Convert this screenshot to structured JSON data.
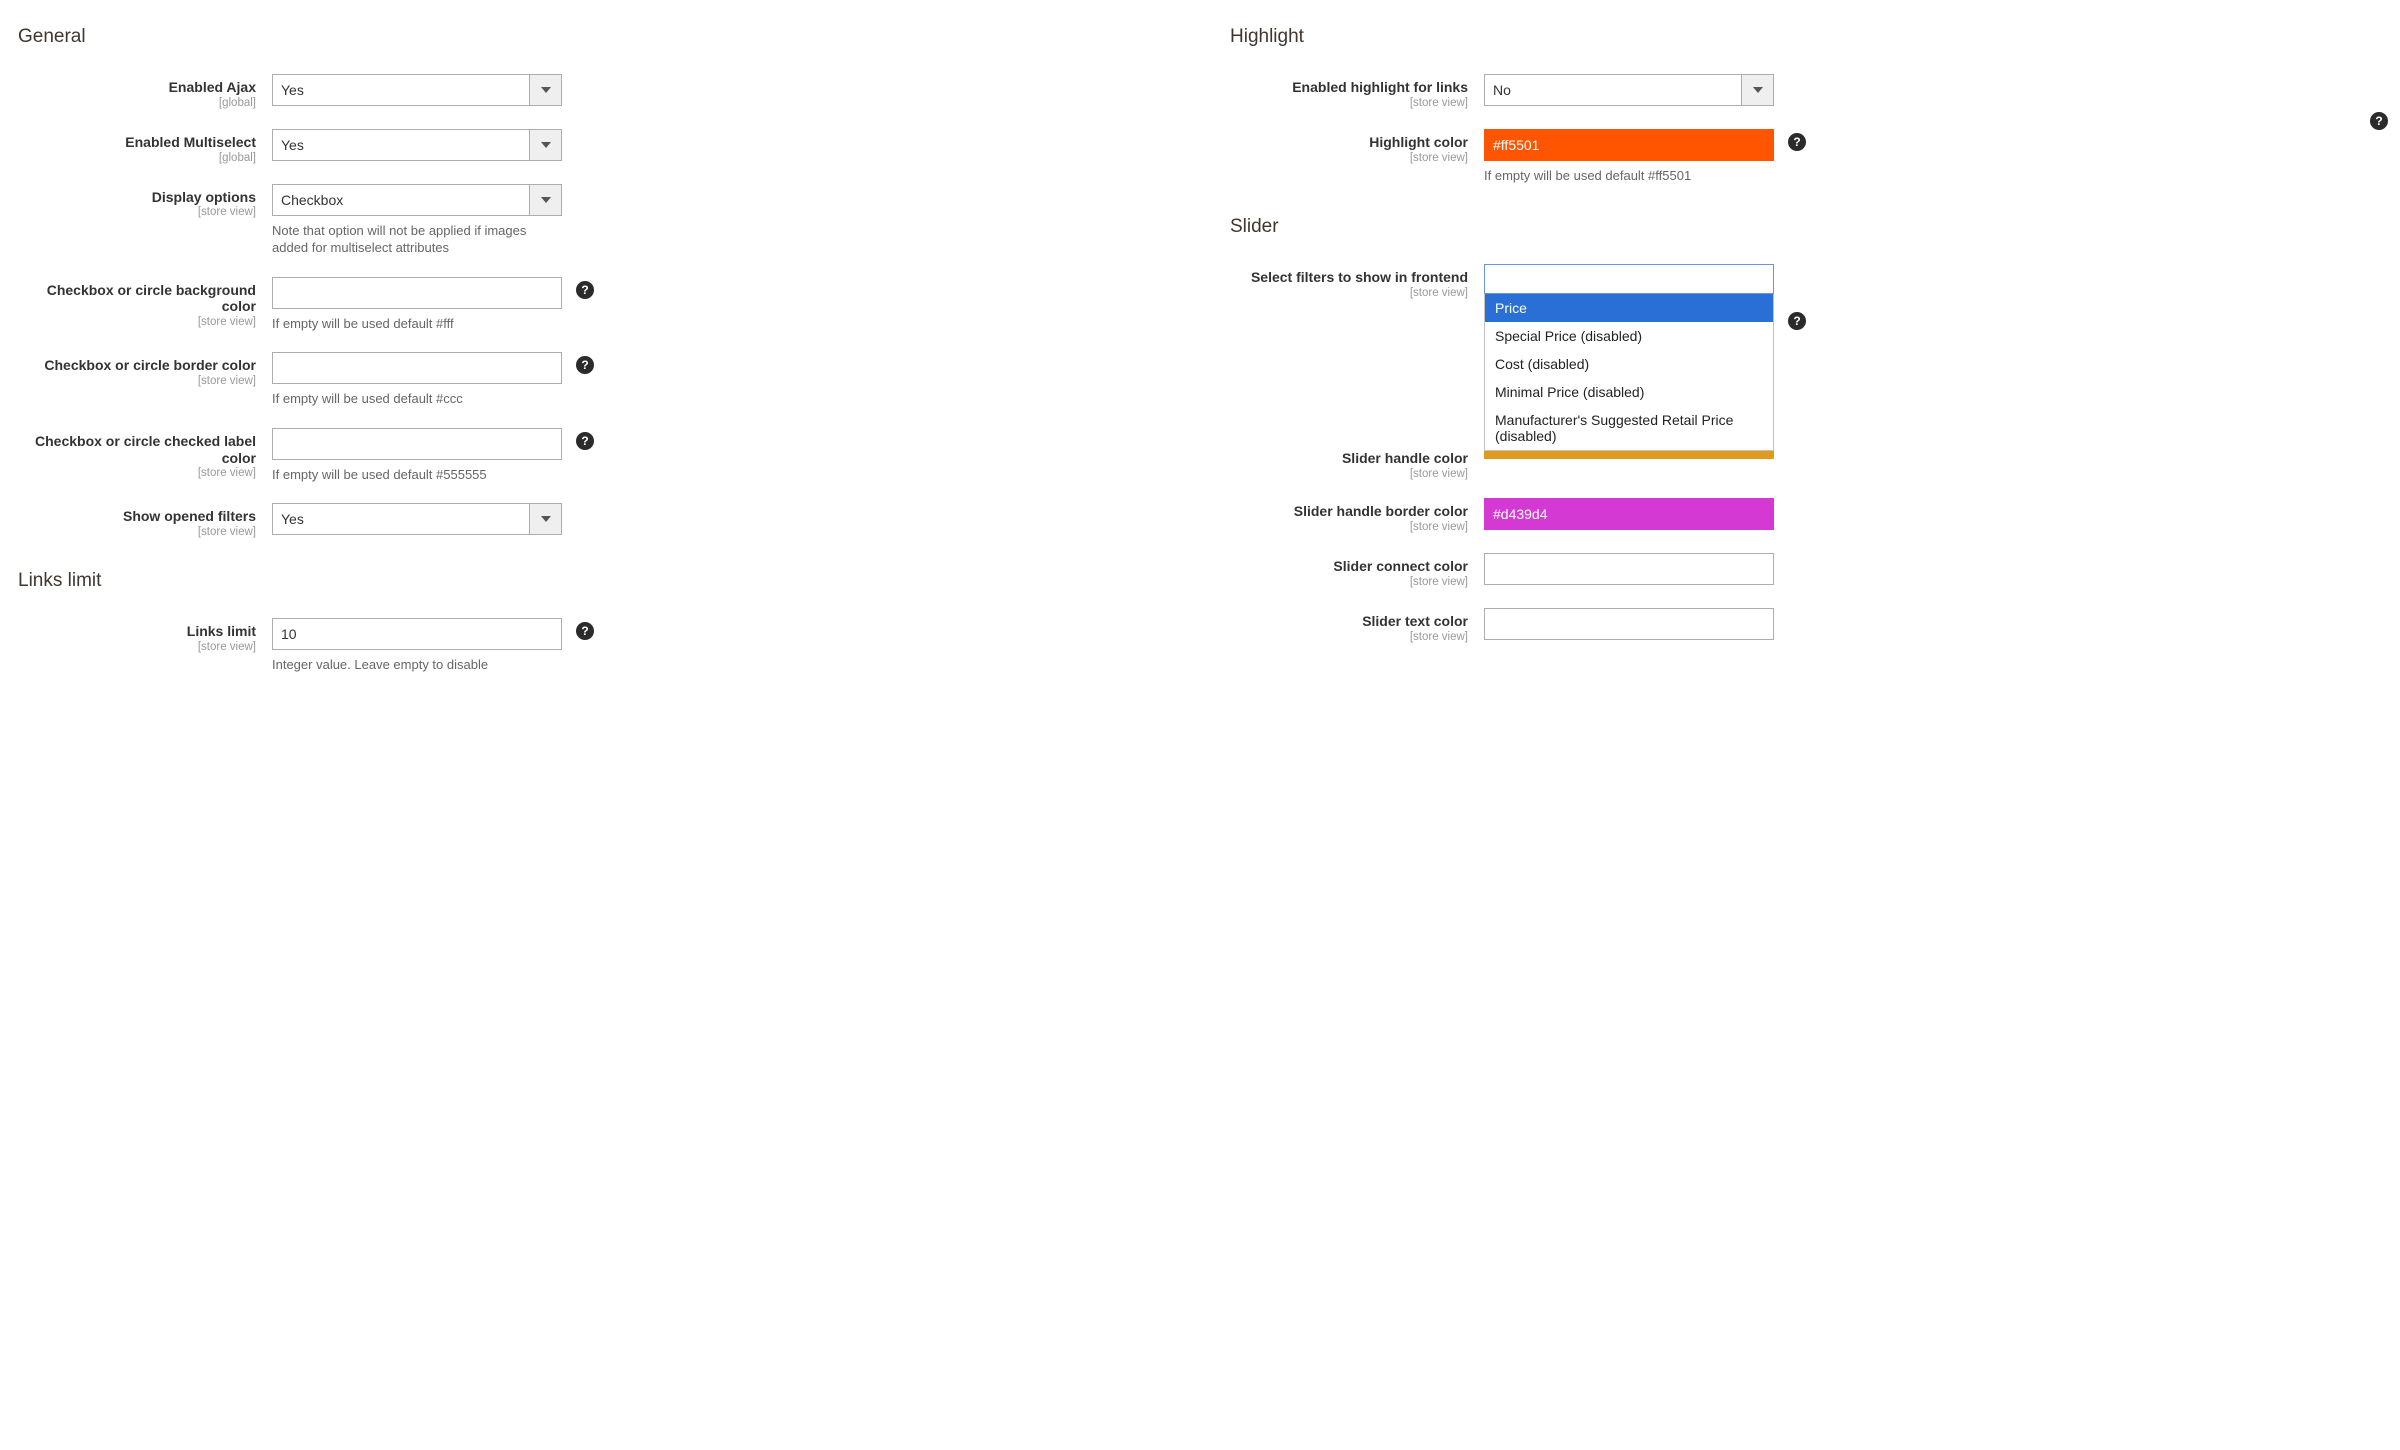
{
  "scope": {
    "global": "[global]",
    "store_view": "[store view]"
  },
  "help_glyph": "?",
  "general": {
    "title": "General",
    "enabled_ajax": {
      "label": "Enabled Ajax",
      "value": "Yes"
    },
    "enabled_multiselect": {
      "label": "Enabled Multiselect",
      "value": "Yes"
    },
    "display_options": {
      "label": "Display options",
      "value": "Checkbox",
      "note": "Note that option will not be applied if images added for multiselect attributes"
    },
    "bg_color": {
      "label": "Checkbox or circle background color",
      "value": "",
      "note": "If empty will be used default #fff"
    },
    "border_color": {
      "label": "Checkbox or circle border color",
      "value": "",
      "note": "If empty will be used default #ccc"
    },
    "checked_label_color": {
      "label": "Checkbox or circle checked label color",
      "value": "",
      "note": "If empty will be used default #555555"
    },
    "show_opened": {
      "label": "Show opened filters",
      "value": "Yes"
    }
  },
  "links_limit": {
    "title": "Links limit",
    "limit": {
      "label": "Links limit",
      "value": "10",
      "note": "Integer value. Leave empty to disable"
    }
  },
  "highlight": {
    "title": "Highlight",
    "enabled": {
      "label": "Enabled highlight for links",
      "value": "No"
    },
    "color": {
      "label": "Highlight color",
      "value": "#ff5501",
      "note": "If empty will be used default #ff5501"
    }
  },
  "slider": {
    "title": "Slider",
    "select_filters": {
      "label": "Select filters to show in frontend",
      "options": [
        {
          "label": "Price",
          "selected": true
        },
        {
          "label": "Special Price (disabled)",
          "selected": false
        },
        {
          "label": "Cost (disabled)",
          "selected": false
        },
        {
          "label": "Minimal Price (disabled)",
          "selected": false
        },
        {
          "label": "Manufacturer's Suggested Retail Price (disabled)",
          "selected": false
        }
      ]
    },
    "handle_color": {
      "label": "Slider handle color",
      "value": ""
    },
    "handle_border_color": {
      "label": "Slider handle border color",
      "value": "#d439d4"
    },
    "connect_color": {
      "label": "Slider connect color",
      "value": ""
    },
    "text_color": {
      "label": "Slider text color",
      "value": ""
    }
  }
}
